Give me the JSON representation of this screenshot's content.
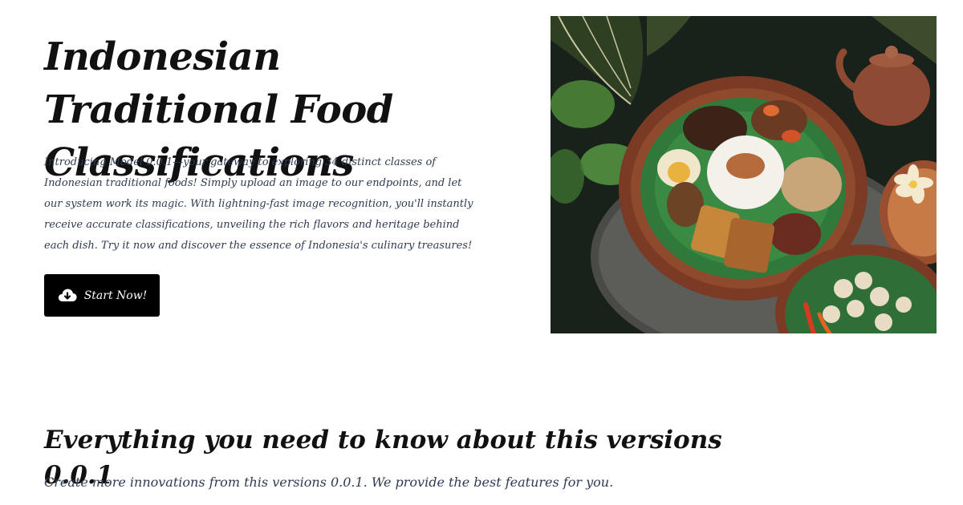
{
  "hero": {
    "title": "Indonesian Traditional Food Classifications",
    "description": "Introducing Model 0.0.1—your gateway to exploring 34 distinct classes of Indonesian traditional foods! Simply upload an image to our endpoints, and let our system work its magic. With lightning-fast image recognition, you'll instantly receive accurate classifications, unveiling the rich flavors and heritage behind each dish. Try it now and discover the essence of Indonesia's culinary treasures!",
    "cta_label": "Start Now!",
    "cta_icon": "cloud-download-icon"
  },
  "section": {
    "title": "Everything you need to know about this versions 0.0.1",
    "subtitle": "Create more innovations from this versions 0.0.1. We provide the best features for you."
  },
  "colors": {
    "text_primary": "#111111",
    "text_secondary": "#2f3b52",
    "button_bg": "#000000",
    "button_text": "#ffffff"
  }
}
